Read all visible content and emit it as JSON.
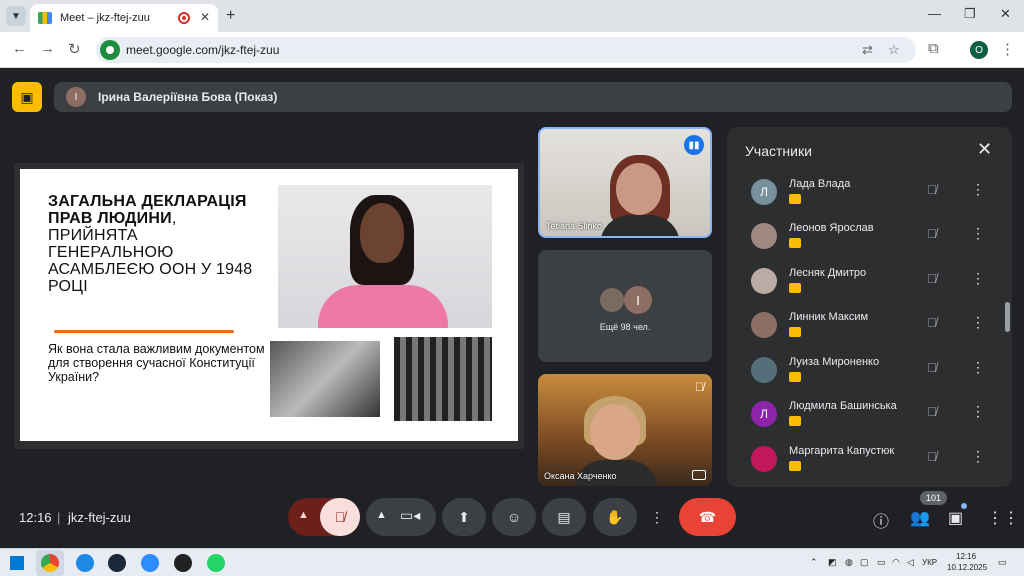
{
  "browser": {
    "tab_title": "Meet – jkz-ftej-zuu",
    "url": "meet.google.com/jkz-ftej-zuu",
    "profile_initial": "O"
  },
  "presenter": {
    "avatar_initial": "I",
    "label": "Ірина Валеріївна Бова (Показ)"
  },
  "slide": {
    "title_bold": "ЗАГАЛЬНА ДЕКЛАРАЦІЯ ПРАВ ЛЮДИНИ",
    "title_rest": ", ПРИЙНЯТА ГЕНЕРАЛЬНОЮ АСАМБЛЕЄЮ ООН У 1948 РОЦІ",
    "question": "Як вона стала важливим документом для створення сучасної Конституції України?"
  },
  "tiles": {
    "tile1_name": "Tetiana Slinko",
    "tile2_avatar_initial": "І",
    "tile2_more": "Ещё 98 чел.",
    "tile3_name": "Оксана Харченко"
  },
  "panel": {
    "title": "Участники",
    "participants": [
      {
        "initial": "Л",
        "name": "Лада Влада",
        "color": "#78909c"
      },
      {
        "initial": "",
        "name": "Леонов Ярослав",
        "color": "#a1887f"
      },
      {
        "initial": "",
        "name": "Лесняк Дмитро",
        "color": "#bcaaa4"
      },
      {
        "initial": "",
        "name": "Линник Максим",
        "color": "#8d6e63"
      },
      {
        "initial": "",
        "name": "Луиза Мироненко",
        "color": "#546e7a"
      },
      {
        "initial": "Л",
        "name": "Людмила Башинська",
        "color": "#8e24aa"
      },
      {
        "initial": "",
        "name": "Маргарита Капустюк",
        "color": "#c2185b"
      }
    ]
  },
  "bottom": {
    "time": "12:16",
    "meeting_code": "jkz-ftej-zuu",
    "people_count": "101"
  },
  "taskbar": {
    "lang": "УКР",
    "time": "12:16",
    "date": "10.12.2025"
  },
  "colors": {
    "meet_bg": "#202124",
    "hangup": "#ea4335",
    "mic_off_bg": "#f9dedc",
    "accent_blue": "#8ab4f8",
    "present_yellow": "#fbbc04"
  }
}
